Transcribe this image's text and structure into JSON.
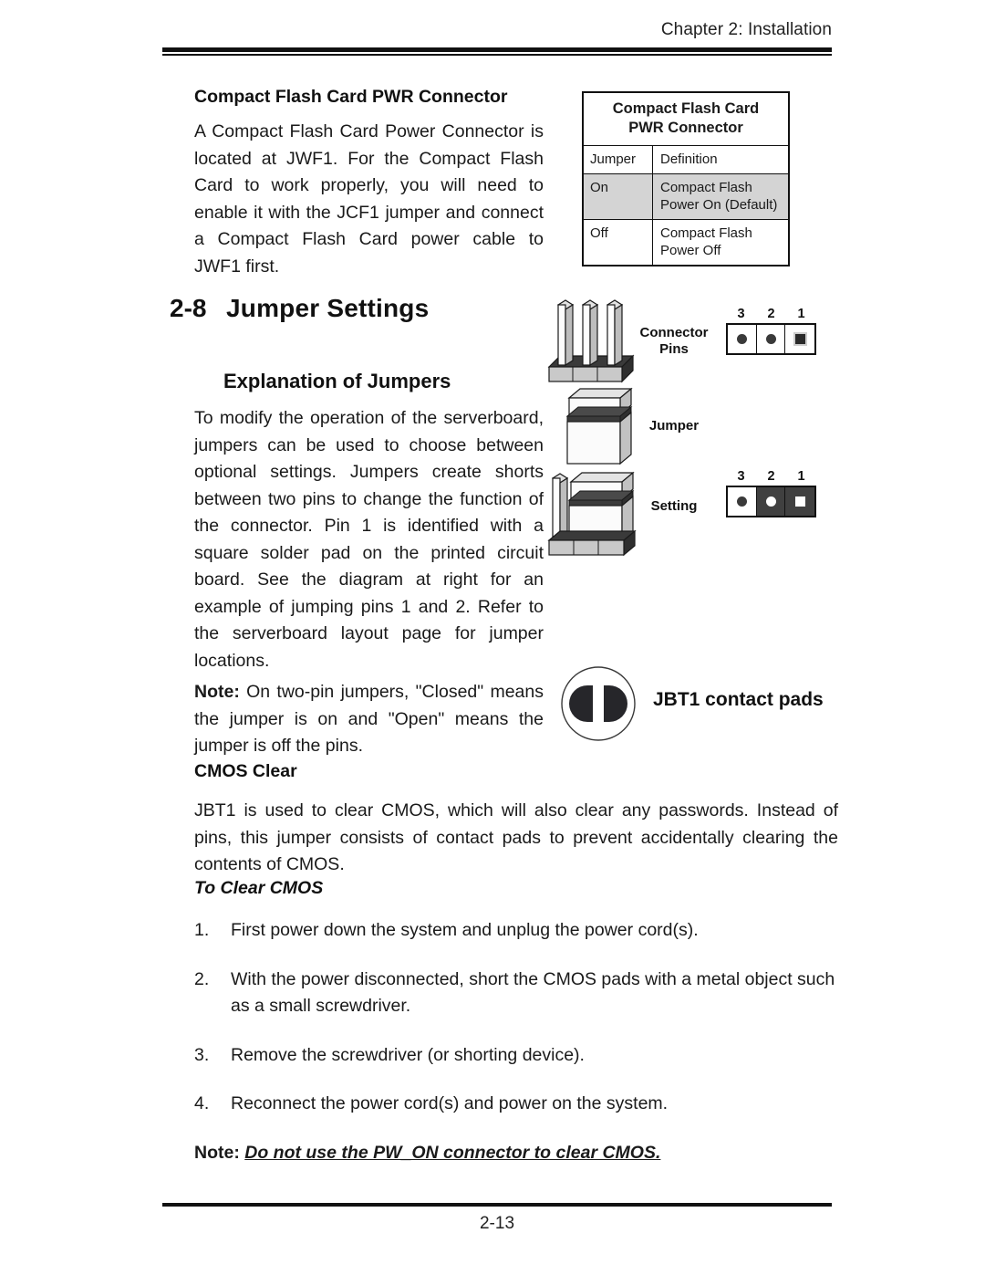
{
  "header": {
    "chapter_title": "Chapter 2: Installation"
  },
  "footer": {
    "page_number": "2-13"
  },
  "left_column": {
    "cf_heading": "Compact Flash Card PWR Connector",
    "cf_paragraph": "A Compact Flash Card Power Connector is located at JWF1. For the Compact Flash Card to work properly, you will need to enable it with the JCF1 jumper and connect a Compact Flash Card power cable to JWF1 first."
  },
  "section": {
    "number": "2-8",
    "title": "Jumper Settings",
    "subheading": "Explanation of Jumpers",
    "explanation_paragraph": "To modify the operation of the serverboard, jumpers can be used to choose between optional settings. Jumpers create shorts between two pins to change the function of the connector. Pin 1 is identified with a square solder pad on the printed circuit board. See the diagram at right for an example of jumping pins 1 and 2. Refer to the serverboard layout page for jumper locations.",
    "note_label": "Note:",
    "note_text": " On two-pin jumpers, \"Closed\" means the jumper is on and \"Open\" means the jumper is off the pins."
  },
  "cmos": {
    "heading": "CMOS Clear",
    "paragraph": "JBT1 is used to clear CMOS, which will also clear any passwords. Instead of pins, this jumper consists of contact pads to prevent accidentally clearing the contents of CMOS.",
    "to_clear_heading": "To Clear CMOS",
    "steps": [
      {
        "num": "1.",
        "text": "First power down the system and unplug the power cord(s)."
      },
      {
        "num": "2.",
        "text": "With the power disconnected, short the CMOS pads with a metal object such as a small screwdriver."
      },
      {
        "num": "3.",
        "text": "Remove the screwdriver (or shorting device)."
      },
      {
        "num": "4.",
        "text": "Reconnect the power cord(s) and power on the system."
      }
    ],
    "final_note_label": "Note:",
    "final_note_text": "Do not use the PW_ON connector to clear CMOS."
  },
  "cf_table": {
    "title_line1": "Compact Flash Card",
    "title_line2": "PWR Connector",
    "columns": [
      "Jumper",
      "Definition"
    ],
    "rows": [
      {
        "jumper": "On",
        "definition_line1": "Compact Flash",
        "definition_line2": "Power On (Default)",
        "shaded": true
      },
      {
        "jumper": "Off",
        "definition_line1": "Compact Flash",
        "definition_line2": "Power Off",
        "shaded": false
      }
    ]
  },
  "jumper_diagram": {
    "labels": {
      "connector_pins_line1": "Connector",
      "connector_pins_line2": "Pins",
      "jumper": "Jumper",
      "setting": "Setting"
    },
    "pin_numbers": [
      "3",
      "2",
      "1"
    ],
    "connector_pins_state": [
      "open",
      "open",
      "open"
    ],
    "setting_state": [
      "open",
      "shorted",
      "shorted"
    ]
  },
  "jbt1": {
    "label": "JBT1 contact pads"
  },
  "colors": {
    "rule": "#111111",
    "table_shade": "#d4d4d4",
    "pin_dark": "#404040",
    "pad_fill": "#26262a"
  }
}
